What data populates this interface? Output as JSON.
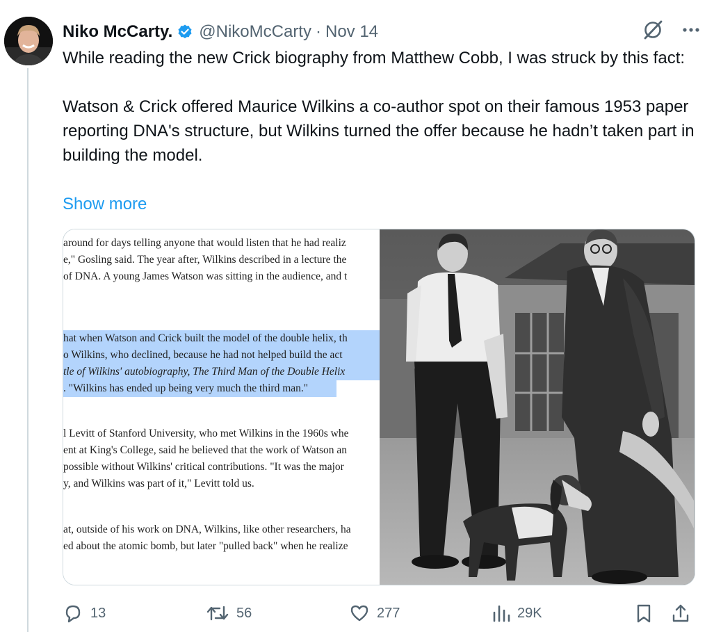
{
  "author": {
    "name": "Niko McCarty.",
    "handle": "@NikoMcCarty",
    "separator": "·",
    "date": "Nov 14"
  },
  "tweet": {
    "paragraph_1": "While reading the new Crick biography from Matthew Cobb, I was struck by this fact:",
    "paragraph_2": "Watson & Crick offered Maurice Wilkins a co-author spot on their famous 1953 paper reporting DNA's structure, but Wilkins turned the offer because he hadn’t taken part in building the model.",
    "show_more": "Show more"
  },
  "media": {
    "document_excerpt": [
      "around for days telling anyone that would listen that he had realiz",
      "e,\" Gosling said. The year after, Wilkins described in a lecture the",
      "of DNA. A young James Watson was sitting in the audience, and t",
      "hat when Watson and Crick built the model of the double helix, th",
      "o Wilkins, who declined, because he had not helped build the act",
      "tle of Wilkins' autobiography, The Third Man of the Double Helix",
      ". \"Wilkins has ended up being very much the third man.\"",
      "l Levitt of Stanford University, who met Wilkins in the 1960s whe",
      "ent at King's College, said he believed that the work of Watson an",
      "possible without Wilkins' critical contributions. \"It was the major",
      "y, and Wilkins was part of it,\" Levitt told us.",
      "at, outside of his work on DNA, Wilkins, like other researchers, ha",
      "ed about the atomic bomb, but later \"pulled back\" when he realize"
    ]
  },
  "actions": {
    "replies": "13",
    "reposts": "56",
    "likes": "277",
    "views": "29K"
  },
  "colors": {
    "text": "#0f1419",
    "secondary": "#536471",
    "link": "#1d9bf0",
    "verified": "#1d9bf0",
    "highlight": "#b3d4fc"
  }
}
